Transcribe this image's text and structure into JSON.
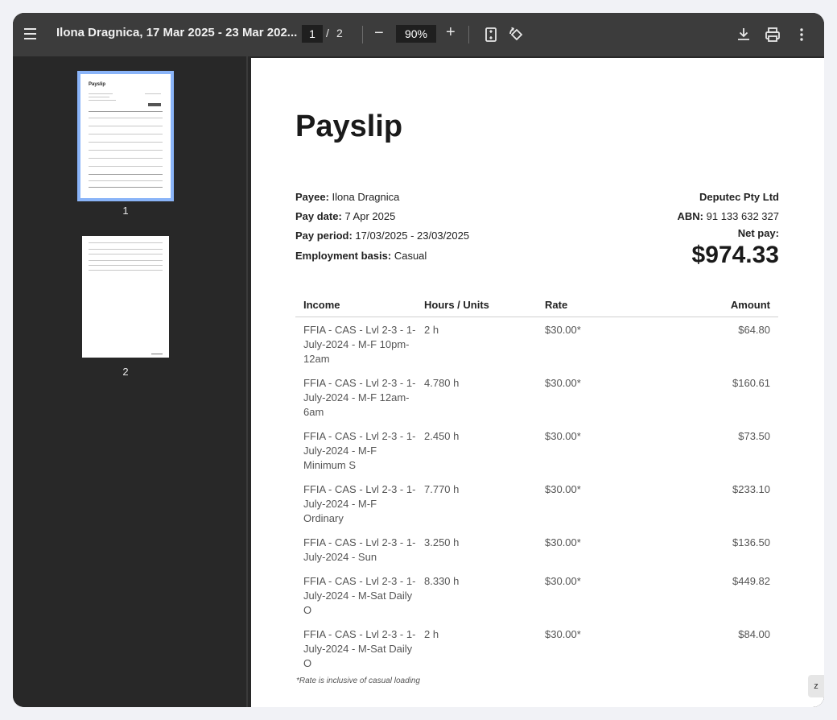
{
  "toolbar": {
    "title": "Ilona Dragnica, 17 Mar 2025 - 23 Mar 202...",
    "page_current": "1",
    "page_separator": "/",
    "page_total": "2",
    "zoom": "90%",
    "icons": [
      "menu-icon",
      "zoom-out-icon",
      "zoom-in-icon",
      "fit-page-icon",
      "rotate-icon",
      "download-icon",
      "print-icon",
      "more-icon"
    ]
  },
  "sidebar": {
    "thumbnails": [
      {
        "label": "1",
        "preview_title": "Payslip"
      },
      {
        "label": "2"
      }
    ]
  },
  "payslip": {
    "title": "Payslip",
    "payee_label": "Payee:",
    "payee": "Ilona Dragnica",
    "pay_date_label": "Pay date:",
    "pay_date": "7 Apr 2025",
    "pay_period_label": "Pay period:",
    "pay_period": "17/03/2025 - 23/03/2025",
    "employment_label": "Employment basis:",
    "employment": "Casual",
    "company": "Deputec Pty Ltd",
    "abn_label": "ABN:",
    "abn": "91 133 632 327",
    "net_pay_label": "Net pay:",
    "net_pay": "$974.33",
    "columns": [
      "Income",
      "Hours / Units",
      "Rate",
      "Amount"
    ],
    "rows": [
      {
        "income": "FFIA - CAS - Lvl 2-3 - 1-July-2024 - M-F 10pm-12am",
        "hours": "2 h",
        "rate": "$30.00*",
        "amount": "$64.80"
      },
      {
        "income": "FFIA - CAS - Lvl 2-3 - 1-July-2024 - M-F 12am-6am",
        "hours": "4.780 h",
        "rate": "$30.00*",
        "amount": "$160.61"
      },
      {
        "income": "FFIA - CAS - Lvl 2-3 - 1-July-2024 - M-F Minimum S",
        "hours": "2.450 h",
        "rate": "$30.00*",
        "amount": "$73.50"
      },
      {
        "income": "FFIA - CAS - Lvl 2-3 - 1-July-2024 - M-F Ordinary",
        "hours": "7.770 h",
        "rate": "$30.00*",
        "amount": "$233.10"
      },
      {
        "income": "FFIA - CAS - Lvl 2-3 - 1-July-2024 - Sun",
        "hours": "3.250 h",
        "rate": "$30.00*",
        "amount": "$136.50"
      },
      {
        "income": "FFIA - CAS - Lvl 2-3 - 1-July-2024 - M-Sat Daily O",
        "hours": "8.330 h",
        "rate": "$30.00*",
        "amount": "$449.82"
      },
      {
        "income": "FFIA - CAS - Lvl 2-3 - 1-July-2024 - M-Sat Daily O",
        "hours": "2 h",
        "rate": "$30.00*",
        "amount": "$84.00"
      }
    ],
    "footnote": "*Rate is inclusive of casual loading"
  },
  "corner_button": "z"
}
